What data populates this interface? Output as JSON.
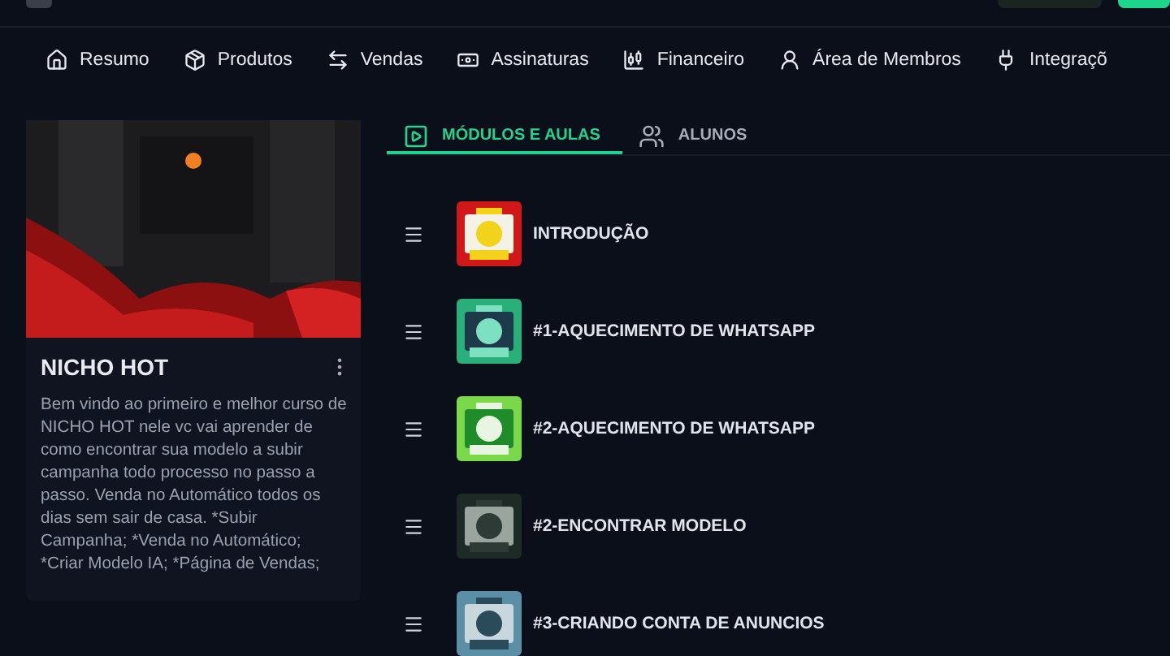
{
  "nav": [
    {
      "label": "Resumo"
    },
    {
      "label": "Produtos"
    },
    {
      "label": "Vendas"
    },
    {
      "label": "Assinaturas"
    },
    {
      "label": "Financeiro"
    },
    {
      "label": "Área de Membros"
    },
    {
      "label": "Integraçõ"
    }
  ],
  "course": {
    "title": "NICHO HOT",
    "description": "Bem vindo ao primeiro e melhor curso de NICHO HOT nele vc vai aprender de como encontrar sua modelo a subir campanha todo processo no passo a passo. Venda no Automático todos os dias sem sair de casa. *Subir Campanha; *Venda no Automático; *Criar Modelo IA; *Página de Vendas;"
  },
  "tabs": [
    {
      "label": "MÓDULOS E AULAS",
      "selected": true
    },
    {
      "label": "ALUNOS",
      "selected": false
    }
  ],
  "modules": [
    {
      "title": "INTRODUÇÃO"
    },
    {
      "title": "#1-AQUECIMENTO DE WHATSAPP"
    },
    {
      "title": "#2-AQUECIMENTO DE WHATSAPP"
    },
    {
      "title": "#2-ENCONTRAR MODELO"
    },
    {
      "title": "#3-CRIANDO CONTA DE ANUNCIOS"
    }
  ]
}
